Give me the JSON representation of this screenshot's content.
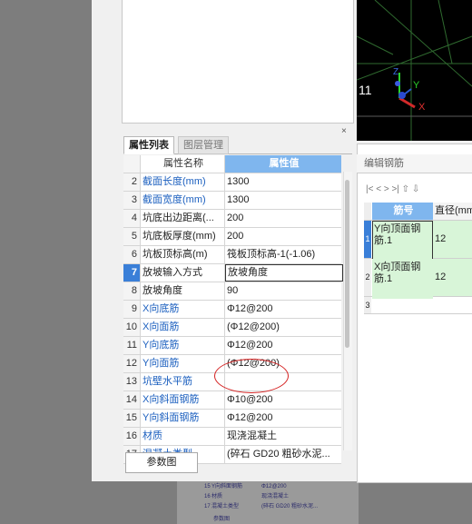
{
  "ghost": {
    "rows": [
      {
        "num": "15",
        "name": "Y向斜面钢筋",
        "val": "Φ12@200"
      },
      {
        "num": "16",
        "name": "材质",
        "val": "现浇混凝土"
      },
      {
        "num": "17",
        "name": "混凝土类型",
        "val": "(碎石 GD20 粗砂水泥..."
      },
      {
        "num": "",
        "name": "参数图",
        "val": ""
      }
    ]
  },
  "viewport": {
    "counter": "11",
    "axis_x": "X",
    "axis_y": "Y",
    "axis_z": "Z"
  },
  "panel_close": "×",
  "tabs": [
    {
      "label": "属性列表"
    },
    {
      "label": "图层管理"
    }
  ],
  "property_table": {
    "header_name": "属性名称",
    "header_value": "属性值",
    "rows": [
      {
        "num": "2",
        "name": "截面长度(mm)",
        "value": "1300"
      },
      {
        "num": "3",
        "name": "截面宽度(mm)",
        "value": "1300"
      },
      {
        "num": "4",
        "name": "坑底出边距离(...",
        "value": "200"
      },
      {
        "num": "5",
        "name": "坑底板厚度(mm)",
        "value": "200"
      },
      {
        "num": "6",
        "name": "坑板顶标高(m)",
        "value": "筏板顶标高-1(-1.06)"
      },
      {
        "num": "7",
        "name": "放坡输入方式",
        "value": "放坡角度"
      },
      {
        "num": "8",
        "name": "放坡角度",
        "value": "90"
      },
      {
        "num": "9",
        "name": "X向底筋",
        "value": "Φ12@200"
      },
      {
        "num": "10",
        "name": "X向面筋",
        "value": "(Φ12@200)"
      },
      {
        "num": "11",
        "name": "Y向底筋",
        "value": "Φ12@200"
      },
      {
        "num": "12",
        "name": "Y向面筋",
        "value": "(Φ12@200)"
      },
      {
        "num": "13",
        "name": "坑壁水平筋",
        "value": ""
      },
      {
        "num": "14",
        "name": "X向斜面钢筋",
        "value": "Φ10@200"
      },
      {
        "num": "15",
        "name": "Y向斜面钢筋",
        "value": "Φ12@200"
      },
      {
        "num": "16",
        "name": "材质",
        "value": "现浇混凝土"
      },
      {
        "num": "17",
        "name": "混凝土类型",
        "value": "(碎石 GD20 粗砂水泥..."
      }
    ]
  },
  "params_button": "参数图",
  "rebar_editor": {
    "title": "编辑钢筋",
    "toolbar": "|<  <  >  >|  ⇧  ⇩",
    "header_name": "筋号",
    "header_diameter": "直径(mm",
    "rows": [
      {
        "num": "1",
        "name": "Y向顶面钢筋.1",
        "diameter": "12"
      },
      {
        "num": "2",
        "name": "X向顶面钢筋.1",
        "diameter": "12"
      },
      {
        "num": "3",
        "name": "",
        "diameter": ""
      }
    ]
  }
}
